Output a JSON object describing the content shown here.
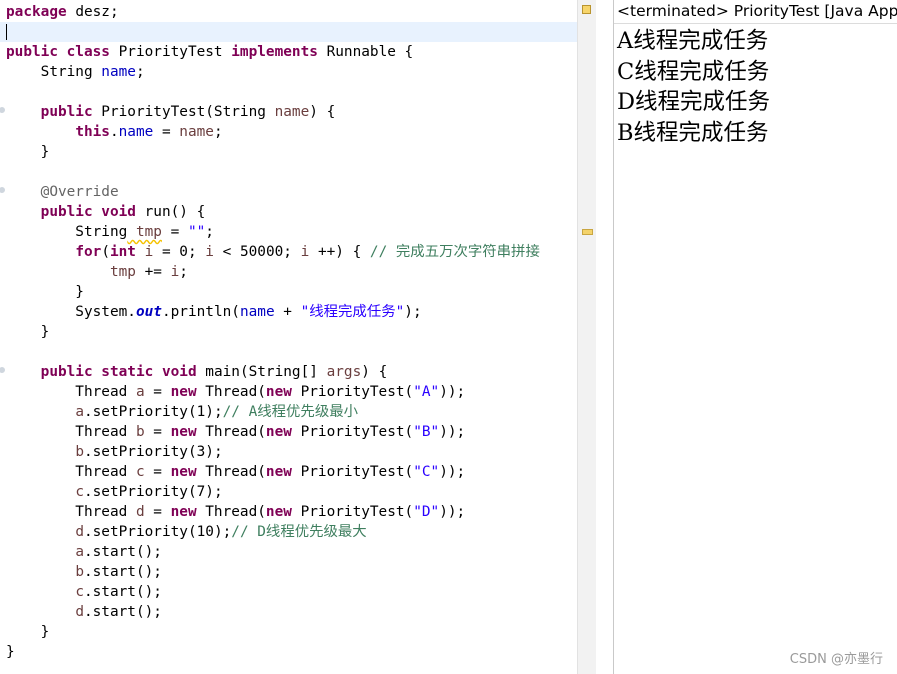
{
  "editor": {
    "lines": [
      [
        [
          "kw",
          "package"
        ],
        [
          "",
          "desz;"
        ]
      ],
      [],
      [
        [
          "kw",
          "public"
        ],
        [
          "",
          ""
        ],
        [
          "kw",
          "class"
        ],
        [
          "",
          "PriorityTest"
        ],
        [
          "kw",
          "implements"
        ],
        [
          "",
          "Runnable {"
        ]
      ],
      [
        [
          "",
          "    String"
        ],
        [
          "fld",
          "name"
        ],
        [
          "",
          ";"
        ]
      ],
      [],
      [
        [
          "",
          "    "
        ],
        [
          "kw",
          "public"
        ],
        [
          "",
          "PriorityTest(String"
        ],
        [
          "var",
          "name"
        ],
        [
          "",
          ") {"
        ]
      ],
      [
        [
          "",
          "        "
        ],
        [
          "kw",
          "this"
        ],
        [
          "",
          "."
        ],
        [
          "fld",
          "name"
        ],
        [
          "",
          "="
        ],
        [
          "var",
          "name"
        ],
        [
          "",
          ";"
        ]
      ],
      [
        [
          "",
          "    }"
        ]
      ],
      [],
      [
        [
          "ann",
          "    @Override"
        ]
      ],
      [
        [
          "",
          "    "
        ],
        [
          "kw",
          "public"
        ],
        [
          "kw",
          "void"
        ],
        [
          "",
          "run() {"
        ]
      ],
      [
        [
          "",
          "        String"
        ],
        [
          "warnvar",
          "tmp"
        ],
        [
          "",
          "="
        ],
        [
          "str",
          "\"\""
        ],
        [
          "",
          ";"
        ]
      ],
      [
        [
          "",
          "        "
        ],
        [
          "kw",
          "for"
        ],
        [
          "",
          "("
        ],
        [
          "kw",
          "int"
        ],
        [
          "var",
          "i"
        ],
        [
          "",
          "= 0;"
        ],
        [
          "var",
          "i"
        ],
        [
          "",
          "< 50000;"
        ],
        [
          "var",
          "i"
        ],
        [
          "",
          "++) {"
        ],
        [
          "cmt",
          "// 完成五万次字符串拼接"
        ]
      ],
      [
        [
          "",
          "            "
        ],
        [
          "var",
          "tmp"
        ],
        [
          "",
          "+="
        ],
        [
          "var",
          "i"
        ],
        [
          "",
          ";"
        ]
      ],
      [
        [
          "",
          "        }"
        ]
      ],
      [
        [
          "",
          "        System."
        ],
        [
          "sfld",
          "out"
        ],
        [
          "",
          ".println("
        ],
        [
          "fld",
          "name"
        ],
        [
          "",
          "+"
        ],
        [
          "str",
          "\"线程完成任务\""
        ],
        [
          "",
          ");"
        ]
      ],
      [
        [
          "",
          "    }"
        ]
      ],
      [],
      [
        [
          "",
          "    "
        ],
        [
          "kw",
          "public"
        ],
        [
          "kw",
          "static"
        ],
        [
          "kw",
          "void"
        ],
        [
          "",
          "main(String[]"
        ],
        [
          "var",
          "args"
        ],
        [
          "",
          ") {"
        ]
      ],
      [
        [
          "",
          "        Thread"
        ],
        [
          "var",
          "a"
        ],
        [
          "",
          "="
        ],
        [
          "kw",
          "new"
        ],
        [
          "",
          "Thread("
        ],
        [
          "kw",
          "new"
        ],
        [
          "",
          "PriorityTest("
        ],
        [
          "str",
          "\"A\""
        ],
        [
          "",
          "));"
        ]
      ],
      [
        [
          "",
          "        "
        ],
        [
          "var",
          "a"
        ],
        [
          "",
          ".setPriority(1);"
        ],
        [
          "cmt",
          "// A线程优先级最小"
        ]
      ],
      [
        [
          "",
          "        Thread"
        ],
        [
          "var",
          "b"
        ],
        [
          "",
          "="
        ],
        [
          "kw",
          "new"
        ],
        [
          "",
          "Thread("
        ],
        [
          "kw",
          "new"
        ],
        [
          "",
          "PriorityTest("
        ],
        [
          "str",
          "\"B\""
        ],
        [
          "",
          "));"
        ]
      ],
      [
        [
          "",
          "        "
        ],
        [
          "var",
          "b"
        ],
        [
          "",
          ".setPriority(3);"
        ]
      ],
      [
        [
          "",
          "        Thread"
        ],
        [
          "var",
          "c"
        ],
        [
          "",
          "="
        ],
        [
          "kw",
          "new"
        ],
        [
          "",
          "Thread("
        ],
        [
          "kw",
          "new"
        ],
        [
          "",
          "PriorityTest("
        ],
        [
          "str",
          "\"C\""
        ],
        [
          "",
          "));"
        ]
      ],
      [
        [
          "",
          "        "
        ],
        [
          "var",
          "c"
        ],
        [
          "",
          ".setPriority(7);"
        ]
      ],
      [
        [
          "",
          "        Thread"
        ],
        [
          "var",
          "d"
        ],
        [
          "",
          "="
        ],
        [
          "kw",
          "new"
        ],
        [
          "",
          "Thread("
        ],
        [
          "kw",
          "new"
        ],
        [
          "",
          "PriorityTest("
        ],
        [
          "str",
          "\"D\""
        ],
        [
          "",
          "));"
        ]
      ],
      [
        [
          "",
          "        "
        ],
        [
          "var",
          "d"
        ],
        [
          "",
          ".setPriority(10);"
        ],
        [
          "cmt",
          "// D线程优先级最大"
        ]
      ],
      [
        [
          "",
          "        "
        ],
        [
          "var",
          "a"
        ],
        [
          "",
          ".start();"
        ]
      ],
      [
        [
          "",
          "        "
        ],
        [
          "var",
          "b"
        ],
        [
          "",
          ".start();"
        ]
      ],
      [
        [
          "",
          "        "
        ],
        [
          "var",
          "c"
        ],
        [
          "",
          ".start();"
        ]
      ],
      [
        [
          "",
          "        "
        ],
        [
          "var",
          "d"
        ],
        [
          "",
          ".start();"
        ]
      ],
      [
        [
          "",
          "    }"
        ]
      ],
      [
        [
          "",
          "}"
        ]
      ]
    ]
  },
  "console": {
    "header": "<terminated> PriorityTest [Java Applic",
    "output": [
      "A线程完成任务",
      "C线程完成任务",
      "D线程完成任务",
      "B线程完成任务"
    ]
  },
  "watermark": "CSDN @亦墨行",
  "colors": {
    "keyword": "#7f0055",
    "field": "#0000c0",
    "string": "#2a00ff",
    "comment": "#3f7f5f",
    "annotation": "#646464",
    "local_variable": "#6a3e3e",
    "current_line": "#e8f2fe"
  }
}
